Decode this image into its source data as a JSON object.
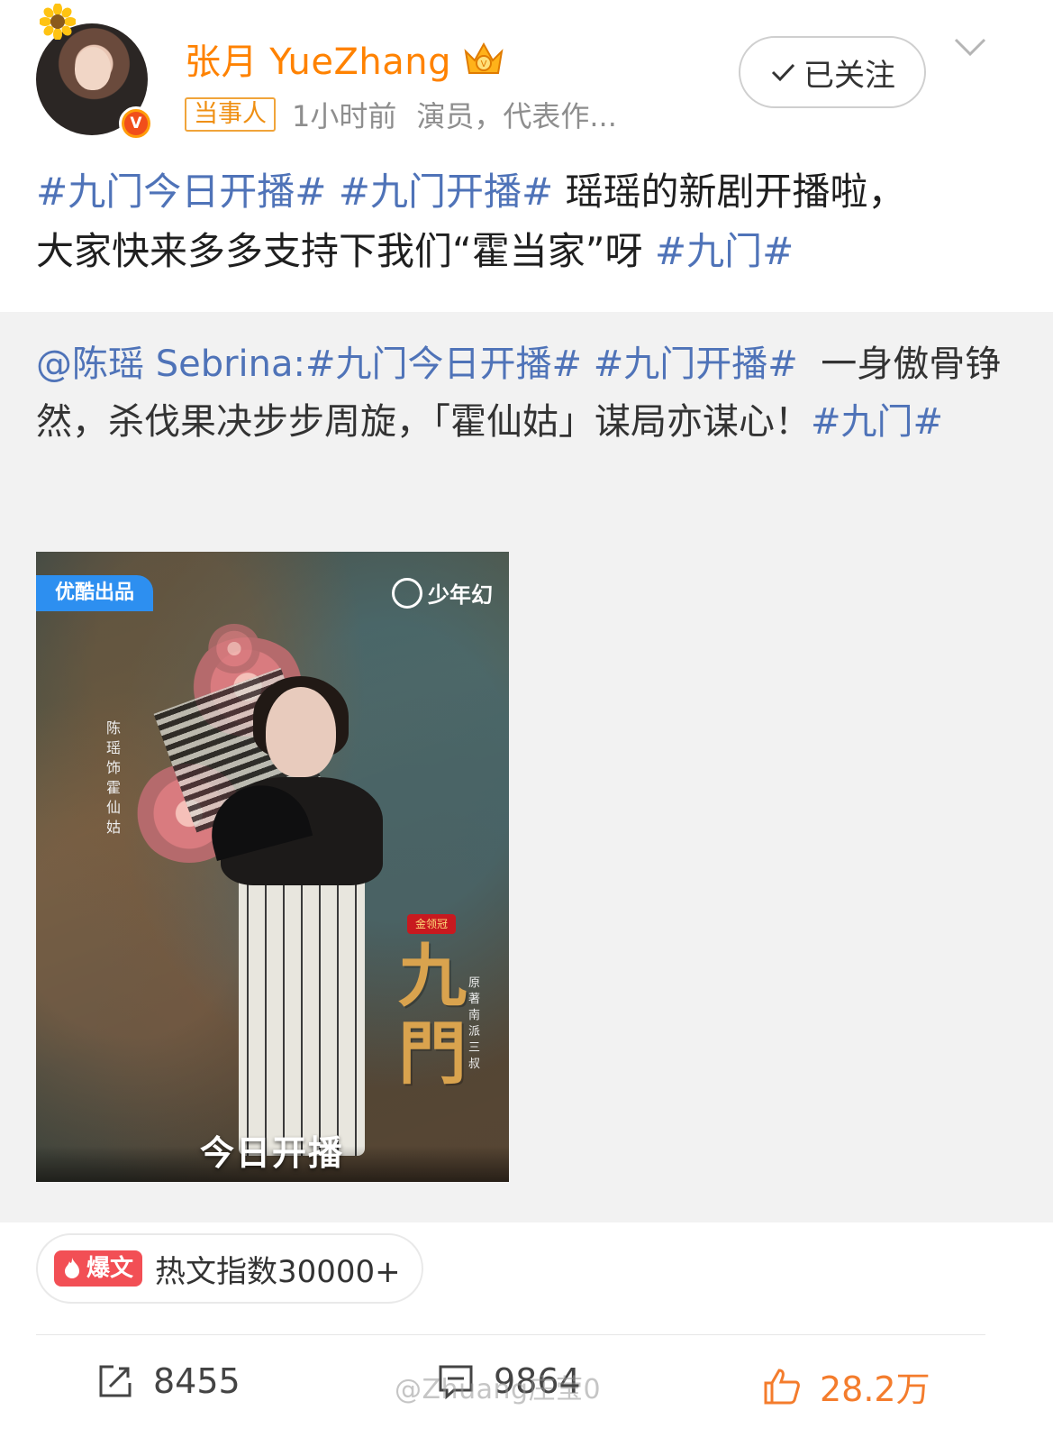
{
  "user": {
    "name": "张月 YueZhang",
    "badge": "当事人",
    "time": "1小时前",
    "description": "演员，代表作..."
  },
  "follow_button": {
    "label": "已关注"
  },
  "post": {
    "tag1": "#九门今日开播#",
    "tag2": "#九门开播#",
    "text1": "瑶瑶的新剧开播啦，",
    "text2": "大家快来多多支持下我们“霍当家”呀",
    "tag3": "#九门#"
  },
  "repost": {
    "mention": "@陈瑶 Sebrina",
    "colon": ":",
    "tag1": "#九门今日开播#",
    "tag2": "#九门开播#",
    "text": "一身傲骨铮然，杀伐果决步步周旋，「霍仙姑」谋局亦谋心！",
    "tag3": "#九门#"
  },
  "poster": {
    "youku_label": "优酷出品",
    "brand_label": "少年幻",
    "cast_text": "陈瑶 饰 霍仙姑",
    "sponsor_badge": "金领冠",
    "title": "九門",
    "author": "原著 南派三叔",
    "airing": "今日开播"
  },
  "hot": {
    "badge": "爆文",
    "text": "热文指数30000+"
  },
  "actions": {
    "repost_count": "8455",
    "comment_count": "9864",
    "like_count": "28.2万"
  },
  "watermark": "@Zhuang庄莹0",
  "colors": {
    "username": "#ff8200",
    "tag": "#4f73b8",
    "like": "#f47c2c",
    "hot_badge": "#f24f55"
  }
}
